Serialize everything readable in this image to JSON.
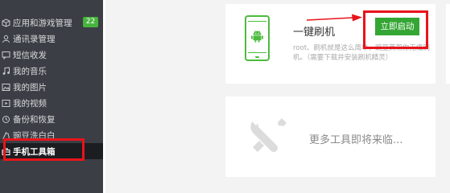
{
  "sidebar": {
    "items": [
      {
        "label": "应用和游戏管理",
        "icon": "cube-icon",
        "badge": "22"
      },
      {
        "label": "通讯录管理",
        "icon": "contact-icon"
      },
      {
        "label": "短信收发",
        "icon": "message-icon"
      },
      {
        "label": "我的音乐",
        "icon": "music-icon"
      },
      {
        "label": "我的图片",
        "icon": "image-icon"
      },
      {
        "label": "我的视频",
        "icon": "video-icon"
      },
      {
        "label": "备份和恢复",
        "icon": "backup-icon"
      },
      {
        "label": "豌豆洗白白",
        "icon": "clean-icon"
      },
      {
        "label": "手机工具箱",
        "icon": "toolbox-icon",
        "active": true
      }
    ]
  },
  "tools": {
    "card1": {
      "title": "一键刷机",
      "description": "root、刷机就是这么简单，豌豆荚帮你无痛刷机。（需要下载并安装刷机精灵）",
      "button_label": "立即启动"
    },
    "card2": {
      "text": "更多工具即将来临..."
    }
  },
  "colors": {
    "sidebar_bg": "#3b3e44",
    "accent_green": "#34a634",
    "highlight_red": "#e8141b"
  }
}
